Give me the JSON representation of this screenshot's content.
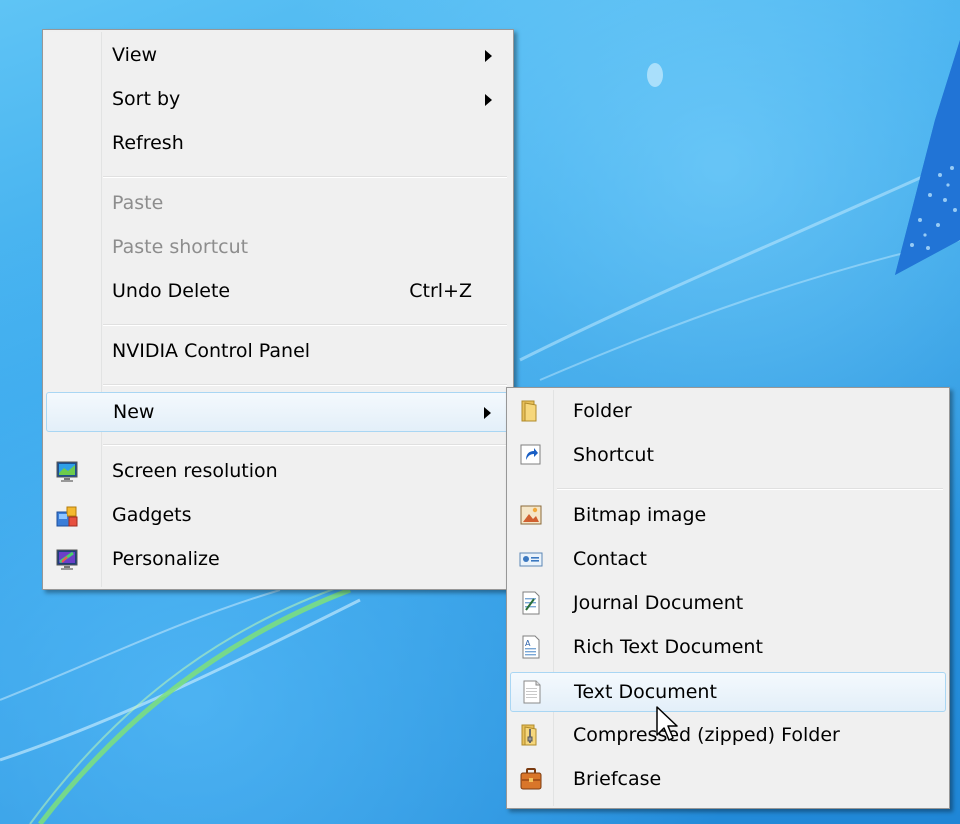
{
  "context_menu": {
    "items": [
      {
        "label": "View",
        "submenu": true
      },
      {
        "label": "Sort by",
        "submenu": true
      },
      {
        "label": "Refresh"
      },
      {
        "label": "Paste",
        "disabled": true
      },
      {
        "label": "Paste shortcut",
        "disabled": true
      },
      {
        "label": "Undo Delete",
        "shortcut": "Ctrl+Z"
      },
      {
        "label": "NVIDIA Control Panel"
      },
      {
        "label": "New",
        "submenu": true,
        "highlighted": true
      },
      {
        "label": "Screen resolution",
        "icon": "screen-resolution-icon"
      },
      {
        "label": "Gadgets",
        "icon": "gadgets-icon"
      },
      {
        "label": "Personalize",
        "icon": "personalize-icon"
      }
    ]
  },
  "new_submenu": {
    "items": [
      {
        "label": "Folder",
        "icon": "folder-icon"
      },
      {
        "label": "Shortcut",
        "icon": "shortcut-icon"
      },
      {
        "label": "Bitmap image",
        "icon": "bitmap-icon"
      },
      {
        "label": "Contact",
        "icon": "contact-icon"
      },
      {
        "label": "Journal Document",
        "icon": "journal-icon"
      },
      {
        "label": "Rich Text Document",
        "icon": "rich-text-icon"
      },
      {
        "label": "Text Document",
        "icon": "text-document-icon",
        "highlighted": true
      },
      {
        "label": "Compressed (zipped) Folder",
        "icon": "zip-folder-icon"
      },
      {
        "label": "Briefcase",
        "icon": "briefcase-icon"
      }
    ]
  },
  "colors": {
    "menu_background": "#f0f0f0",
    "highlight_border": "#a9d6f3",
    "disabled_text": "#8d8d8d",
    "desktop_blue": "#2b95df"
  }
}
